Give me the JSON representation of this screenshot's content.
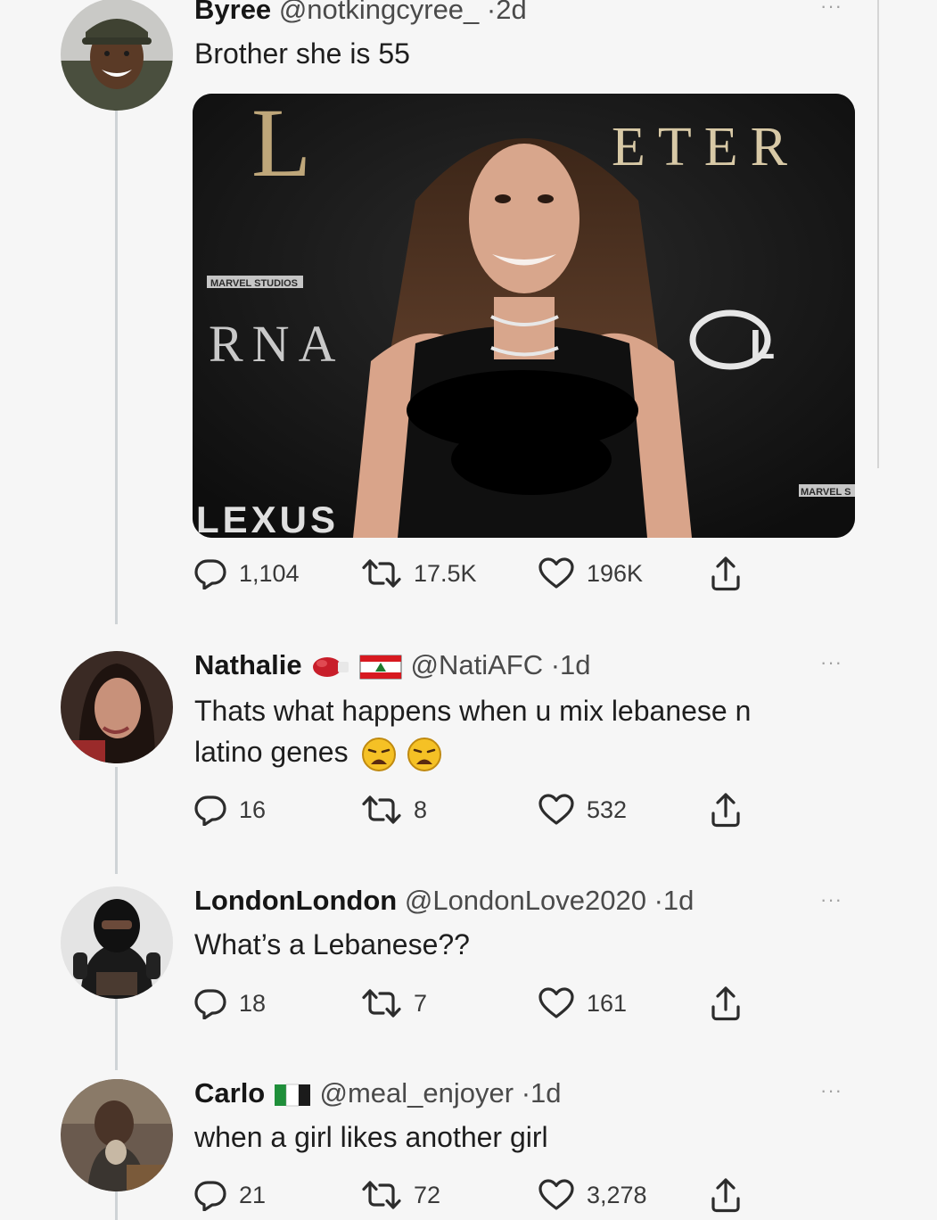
{
  "tweets": [
    {
      "name": "Byree",
      "handle": "@notkingcyree_",
      "time": "2d",
      "text": "Brother she is 55",
      "replies": "1,104",
      "retweets": "17.5K",
      "likes": "196K"
    },
    {
      "name": "Nathalie",
      "handle": "@NatiAFC",
      "time": "1d",
      "text_line1": "Thats what happens when u mix lebanese n",
      "text_line2": "latino genes",
      "replies": "16",
      "retweets": "8",
      "likes": "532"
    },
    {
      "name": "LondonLondon",
      "handle": "@LondonLove2020",
      "time": "1d",
      "text": "What’s a Lebanese??",
      "replies": "18",
      "retweets": "7",
      "likes": "161"
    },
    {
      "name": "Carlo",
      "handle": "@meal_enjoyer",
      "time": "1d",
      "text": "when a girl likes another girl",
      "replies": "21",
      "retweets": "72",
      "likes": "3,278"
    }
  ],
  "media": {
    "backdrop_left": "L",
    "backdrop_right": "ETER",
    "backdrop_mid": "RNA",
    "studio": "MARVEL STUDIOS",
    "sponsor": "LEXUS",
    "corner": "MARVEL S"
  },
  "more_label": "···",
  "separator": "·",
  "colors": {
    "background": "#f6f6f6",
    "text": "#1b1b1b",
    "muted": "#4a4a4a",
    "thread_line": "#cfd3d6"
  },
  "icons": [
    "reply-icon",
    "retweet-icon",
    "like-icon",
    "share-icon",
    "more-icon",
    "boxing-glove-icon",
    "lebanon-flag-icon",
    "italy-flag-icon",
    "weary-face-emoji"
  ]
}
